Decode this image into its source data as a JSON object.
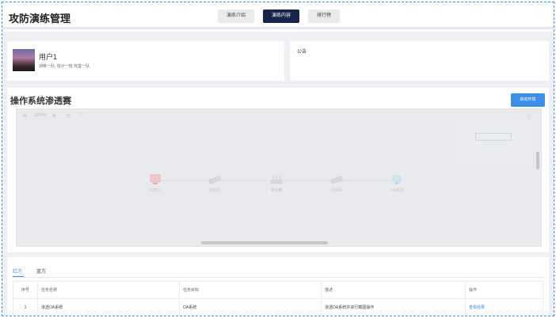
{
  "header": {
    "title": "攻防演练管理",
    "tabs": [
      {
        "label": "演练介绍",
        "active": false
      },
      {
        "label": "演练内容",
        "active": true
      },
      {
        "label": "排行榜",
        "active": false
      }
    ]
  },
  "user": {
    "name": "用户1",
    "subtitle": "训练一队, 信计一班 完善一队"
  },
  "notice": {
    "title": "公告"
  },
  "topology": {
    "title": "操作系统渗透赛",
    "start_button": "启动环境",
    "zoom_level": "100%",
    "nodes": [
      {
        "label": "攻击机",
        "icon": "attacker-icon"
      },
      {
        "label": "交换机",
        "icon": "switch-icon"
      },
      {
        "label": "路由器",
        "icon": "router-icon"
      },
      {
        "label": "交换机",
        "icon": "switch-icon"
      },
      {
        "label": "OA系统",
        "icon": "server-icon"
      }
    ]
  },
  "tasks": {
    "team_tabs": [
      {
        "label": "红方",
        "active": true
      },
      {
        "label": "蓝方",
        "active": false
      }
    ],
    "columns": [
      "序号",
      "任务名称",
      "任务目标",
      "描述",
      "操作"
    ],
    "rows": [
      {
        "index": "1",
        "name": "渗透OA系统",
        "target": "OA系统",
        "description": "渗透OA系统并进行截图操作",
        "action": "查看结果"
      }
    ]
  },
  "colors": {
    "accent": "#3d8fe8",
    "active_tab": "#162447",
    "frame_border": "#2f9bff"
  }
}
